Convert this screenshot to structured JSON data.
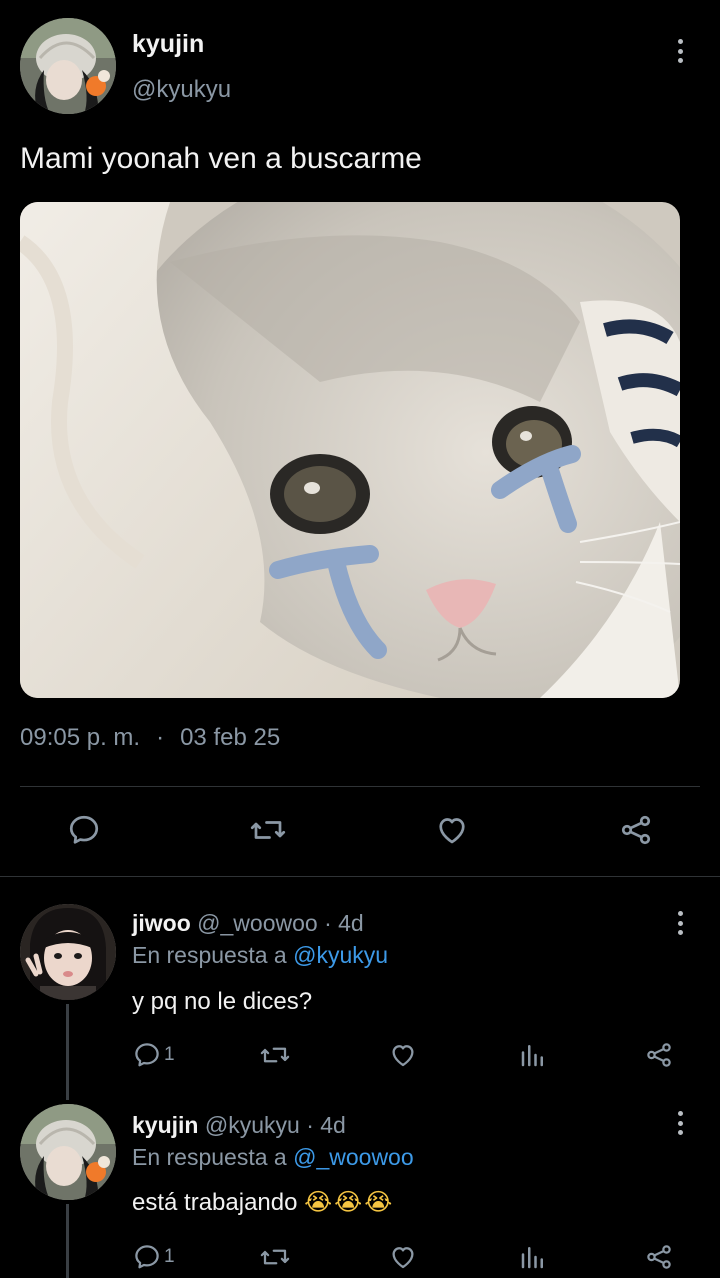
{
  "main_tweet": {
    "author_name": "kyujin",
    "author_handle": "@kyukyu",
    "text": "Mami yoonah ven a buscarme",
    "time": "09:05 p. m.",
    "separator": "·",
    "date": "03 feb 25"
  },
  "replies": [
    {
      "author_name": "jiwoo",
      "author_handle": "@_woowoo",
      "meta": "· 4d",
      "reply_prefix": "En respuesta a",
      "reply_to": "@kyukyu",
      "text": "y pq no le dices?",
      "reply_count": "1"
    },
    {
      "author_name": "kyujin",
      "author_handle": "@kyukyu",
      "meta": "· 4d",
      "reply_prefix": "En respuesta a",
      "reply_to": "@_woowoo",
      "text": "está trabajando",
      "emoji": "😭😭😭",
      "reply_count": "1"
    }
  ],
  "icons": {
    "more": "more-vertical-icon",
    "reply": "comment-bubble-icon",
    "retweet": "retweet-icon",
    "like": "heart-icon",
    "share": "share-icon",
    "views": "analytics-bars-icon"
  },
  "colors": {
    "background": "#000000",
    "text": "#e7e9ea",
    "muted": "#8b98a5",
    "link": "#3d9ae8",
    "divider": "#2f3336",
    "tear": "#8fa6c8"
  }
}
